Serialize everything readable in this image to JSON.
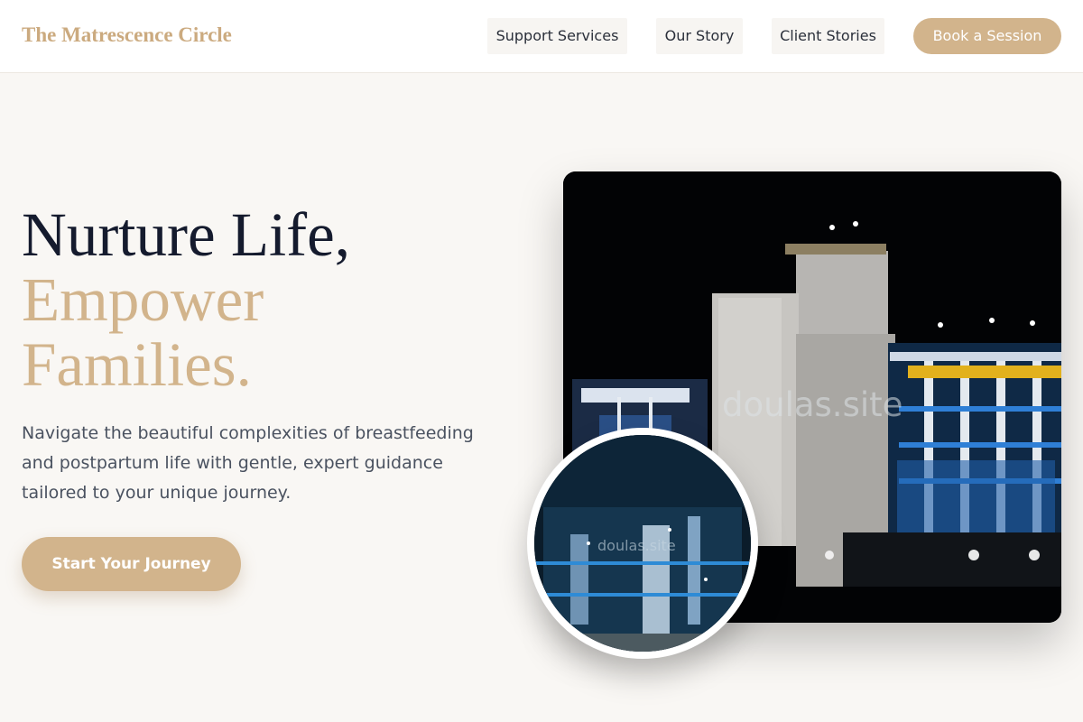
{
  "header": {
    "brand": "The Matrescence Circle",
    "nav": [
      {
        "label": "Support Services"
      },
      {
        "label": "Our Story"
      },
      {
        "label": "Client Stories"
      }
    ],
    "cta_label": "Book a Session"
  },
  "hero": {
    "headline_line1": "Nurture Life,",
    "headline_line2": "Empower",
    "headline_line3": "Families.",
    "description": "Navigate the beautiful complexities of breastfeeding and postpartum life with gentle, expert guidance tailored to your unique journey.",
    "cta_label": "Start Your Journey"
  },
  "images": {
    "main_watermark": "doulas.site",
    "circle_watermark": "doulas.site"
  },
  "colors": {
    "accent": "#d2b48c",
    "brand": "#cbaa7f",
    "heading": "#151b2e",
    "body_text": "#4a5260",
    "background": "#f9f7f4"
  }
}
